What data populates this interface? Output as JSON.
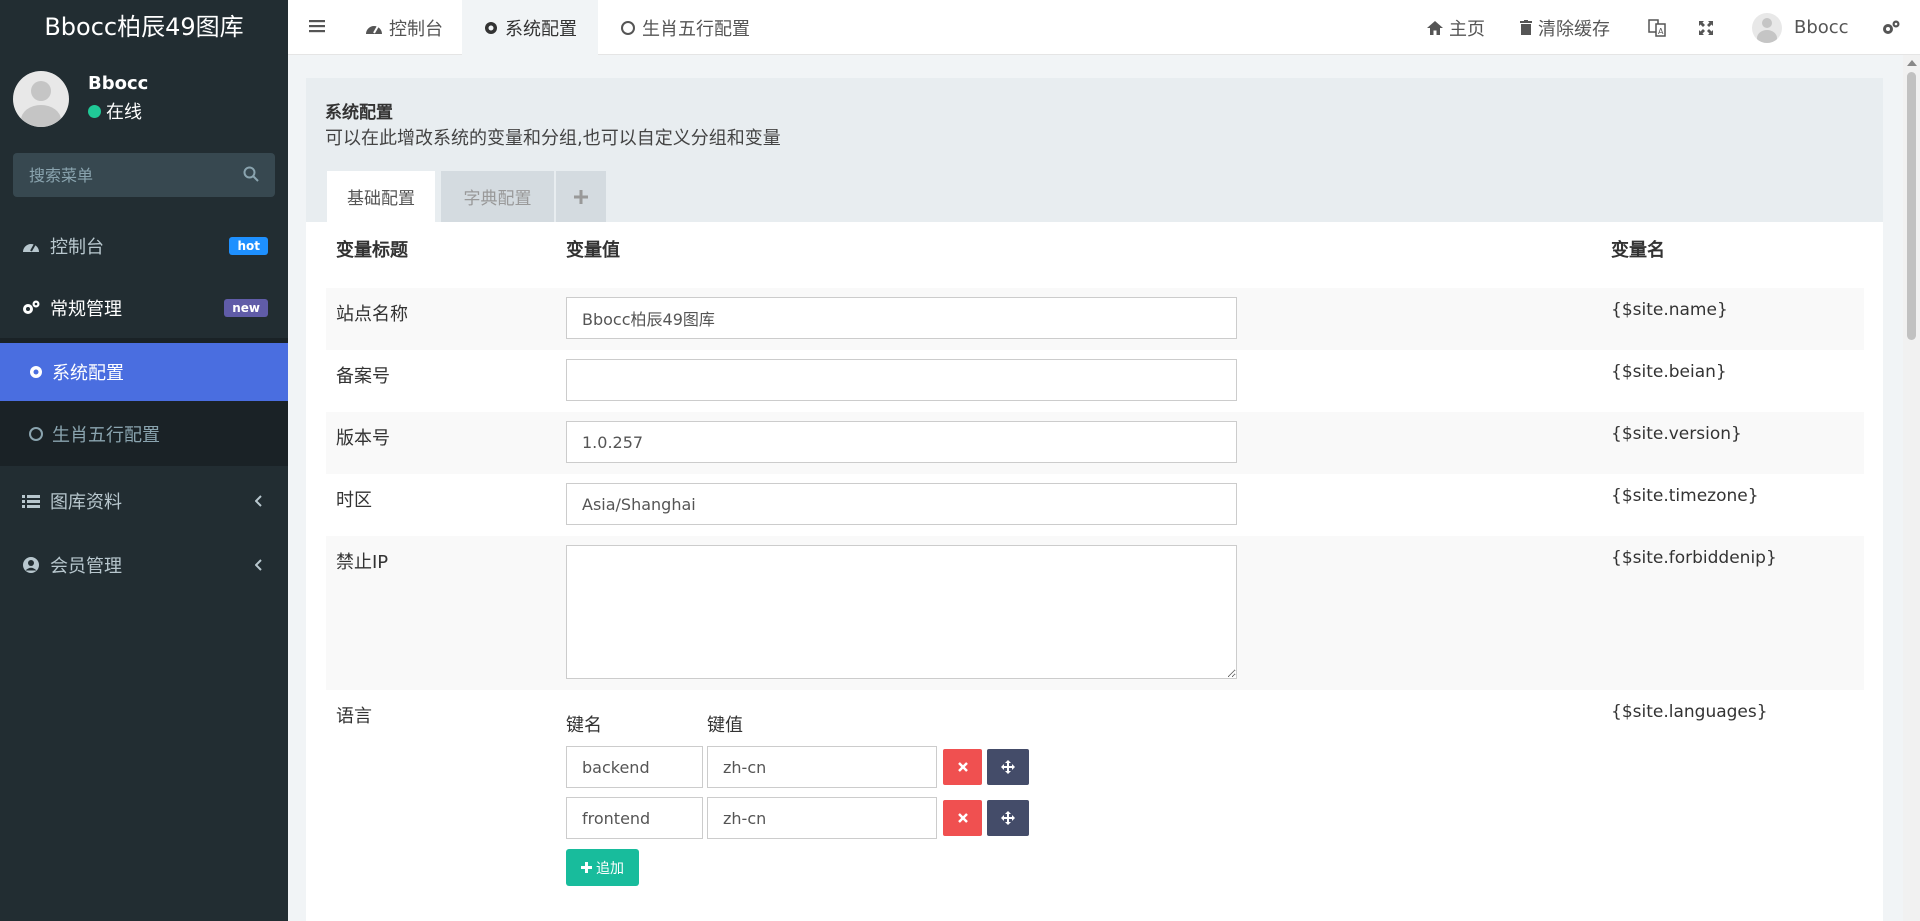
{
  "sidebar": {
    "brand": "Bbocc柏辰49图库",
    "user": {
      "name": "Bbocc",
      "status": "在线"
    },
    "search_placeholder": "搜索菜单",
    "menu": [
      {
        "label": "控制台",
        "badge": "hot",
        "icon": "dashboard-icon"
      },
      {
        "label": "常规管理",
        "badge": "new",
        "icon": "cogs-icon"
      },
      {
        "label": "图库资料",
        "icon": "list-icon"
      },
      {
        "label": "会员管理",
        "icon": "user-circle-icon"
      }
    ],
    "submenu": [
      {
        "label": "系统配置",
        "active": true,
        "icon": "gear-icon"
      },
      {
        "label": "生肖五行配置",
        "active": false,
        "icon": "circle-icon"
      }
    ]
  },
  "topbar": {
    "tabs": [
      {
        "label": "控制台"
      },
      {
        "label": "系统配置"
      },
      {
        "label": "生肖五行配置"
      }
    ],
    "home": "主页",
    "clear_cache": "清除缓存",
    "username": "Bbocc"
  },
  "panel": {
    "title": "系统配置",
    "desc": "可以在此增改系统的变量和分组,也可以自定义分组和变量",
    "tabs": [
      "基础配置",
      "字典配置"
    ]
  },
  "table": {
    "headers": {
      "title": "变量标题",
      "value": "变量值",
      "name": "变量名"
    },
    "rows": [
      {
        "title": "站点名称",
        "value": "Bbocc柏辰49图库",
        "var": "{$site.name}"
      },
      {
        "title": "备案号",
        "value": "",
        "var": "{$site.beian}"
      },
      {
        "title": "版本号",
        "value": "1.0.257",
        "var": "{$site.version}"
      },
      {
        "title": "时区",
        "value": "Asia/Shanghai",
        "var": "{$site.timezone}"
      },
      {
        "title": "禁止IP",
        "value": "",
        "var": "{$site.forbiddenip}"
      },
      {
        "title": "语言",
        "var": "{$site.languages}"
      }
    ],
    "languages": {
      "key_header": "键名",
      "value_header": "键值",
      "pairs": [
        {
          "key": "backend",
          "value": "zh-cn"
        },
        {
          "key": "frontend",
          "value": "zh-cn"
        }
      ],
      "add_label": "追加"
    }
  },
  "colors": {
    "sidebar_bg": "#222d32",
    "active_blue": "#4a6ee0",
    "success": "#18bc9c",
    "danger": "#f05050"
  }
}
